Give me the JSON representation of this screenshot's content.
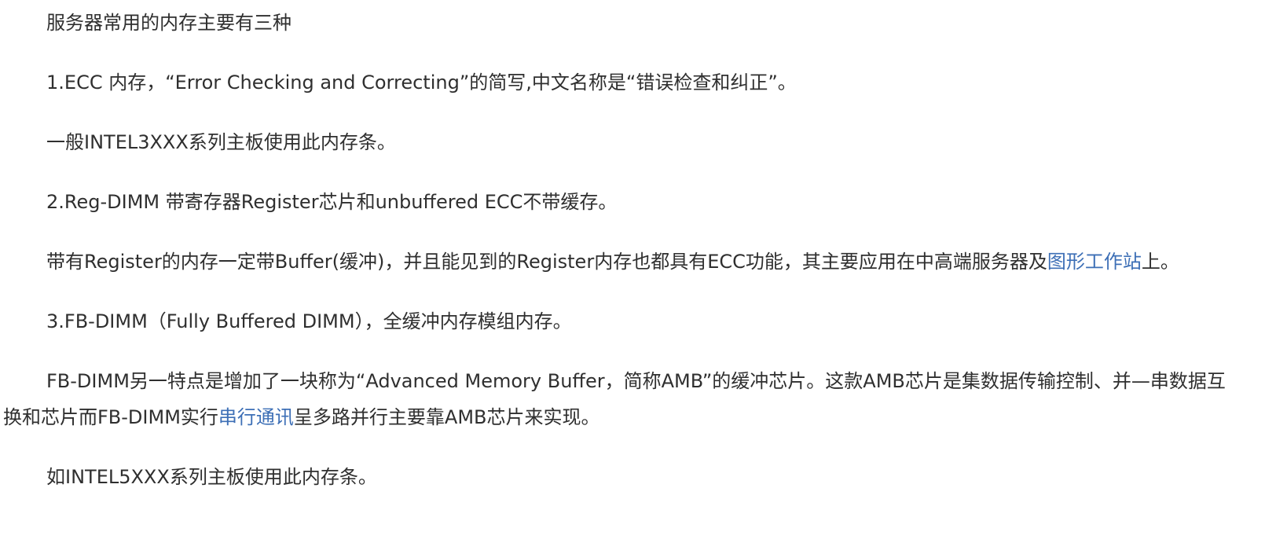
{
  "article": {
    "p1": "服务器常用的内存主要有三种",
    "p2": "1.ECC 内存，“Error Checking and Correcting”的简写,中文名称是“错误检查和纠正”。",
    "p3": "一般INTEL3XXX系列主板使用此内存条。",
    "p4": "2.Reg-DIMM 带寄存器Register芯片和unbuffered ECC不带缓存。",
    "p5": {
      "before": "带有Register的内存一定带Buffer(缓冲)，并且能见到的Register内存也都具有ECC功能，其主要应用在中高端服务器及",
      "link": "图形工作站",
      "after": "上。"
    },
    "p6": "3.FB-DIMM（Fully Buffered DIMM），全缓冲内存模组内存。",
    "p7": {
      "before": "FB-DIMM另一特点是增加了一块称为“Advanced Memory Buffer，简称AMB”的缓冲芯片。这款AMB芯片是集数据传输控制、并—串数据互换和芯片而FB-DIMM实行",
      "link": "串行通讯",
      "after": "呈多路并行主要靠AMB芯片来实现。"
    },
    "p8": "如INTEL5XXX系列主板使用此内存条。"
  },
  "colors": {
    "text": "#2f2f2f",
    "link": "#3d6fb6",
    "background": "#ffffff"
  }
}
